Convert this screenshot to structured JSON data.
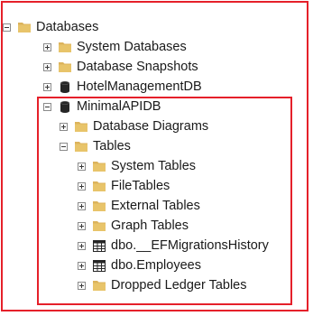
{
  "tree": {
    "databases": {
      "label": "Databases",
      "icon": "folder-icon",
      "expanded": true,
      "children": {
        "system_databases": {
          "label": "System Databases",
          "icon": "folder-icon",
          "expanded": false
        },
        "database_snapshots": {
          "label": "Database Snapshots",
          "icon": "folder-icon",
          "expanded": false
        },
        "hotel_management_db": {
          "label": "HotelManagementDB",
          "icon": "database-icon",
          "expanded": false
        },
        "minimal_api_db": {
          "label": "MinimalAPIDB",
          "icon": "database-icon",
          "expanded": true,
          "children": {
            "database_diagrams": {
              "label": "Database Diagrams",
              "icon": "folder-icon",
              "expanded": false
            },
            "tables": {
              "label": "Tables",
              "icon": "folder-icon",
              "expanded": true,
              "children": {
                "system_tables": {
                  "label": "System Tables",
                  "icon": "folder-icon"
                },
                "file_tables": {
                  "label": "FileTables",
                  "icon": "folder-icon"
                },
                "external_tables": {
                  "label": "External Tables",
                  "icon": "folder-icon"
                },
                "graph_tables": {
                  "label": "Graph Tables",
                  "icon": "folder-icon"
                },
                "ef_migrations_history": {
                  "label": "dbo.__EFMigrationsHistory",
                  "icon": "table-icon"
                },
                "employees": {
                  "label": "dbo.Employees",
                  "icon": "table-icon"
                },
                "dropped_ledger_tables": {
                  "label": "Dropped Ledger Tables",
                  "icon": "folder-icon"
                }
              }
            }
          }
        }
      }
    }
  },
  "colors": {
    "highlight_border": "#e5202a",
    "folder": "#dcb35c",
    "text": "#1a1a1a"
  }
}
